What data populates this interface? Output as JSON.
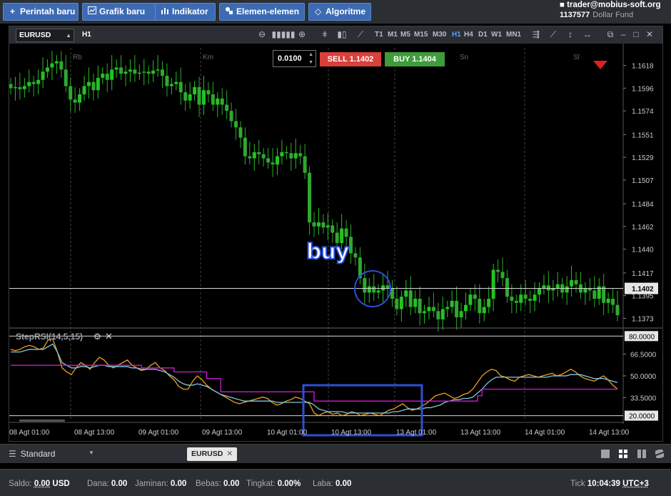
{
  "toolbar": {
    "new_order": "Perintah baru",
    "new_chart": "Grafik baru",
    "indicator": "Indikator",
    "elements": "Elemen-elemen",
    "algorithm": "Algoritme"
  },
  "account": {
    "email": "trader@mobius-soft.org",
    "number": "1137577",
    "fund": "Dollar Fund"
  },
  "chart": {
    "symbol": "EURUSD",
    "timeframe": "H1",
    "timeframes": [
      "T1",
      "M1",
      "M5",
      "M15",
      "M30",
      "H1",
      "H4",
      "D1",
      "W1",
      "MN1"
    ],
    "active_timeframe": "H1",
    "lot": "0.0100",
    "sell_label": "SELL",
    "sell_price": "1.1402",
    "buy_label": "BUY",
    "buy_price": "1.1404",
    "current_price": "1.1402",
    "day_markers": [
      "Rb",
      "Km",
      "Sn",
      "Sl"
    ],
    "annotation_buy": "buy",
    "colors": {
      "bull": "#22c322",
      "bear": "#2fa82f",
      "sell": "#d9403a",
      "buy": "#3e9c3a",
      "annotation": "#2b4fd8"
    }
  },
  "indicator": {
    "name": "StepRSI(14,5,15)",
    "levels": [
      "80.0000",
      "66.5000",
      "50.0000",
      "33.5000",
      "20.0000"
    ],
    "colors": {
      "rsi": "#f0a020",
      "fast": "#7fc8e0",
      "slow": "#d21ad2"
    }
  },
  "chart_data": {
    "type": "candlestick",
    "instrument": "EURUSD",
    "timeframe": "H1",
    "y_ticks": [
      1.1618,
      1.1596,
      1.1574,
      1.1551,
      1.1529,
      1.1507,
      1.1484,
      1.1462,
      1.144,
      1.1417,
      1.1395,
      1.1373
    ],
    "ylim": [
      1.1365,
      1.1635
    ],
    "x_ticks": [
      "08 Agt 01:00",
      "08 Agt 13:00",
      "09 Agt 01:00",
      "09 Agt 13:00",
      "10 Agt 01:00",
      "10 Agt 13:00",
      "13 Agt 01:00",
      "13 Agt 13:00",
      "14 Agt 01:00",
      "14 Agt 13:00"
    ],
    "close": [
      1.1596,
      1.1597,
      1.1595,
      1.1598,
      1.1602,
      1.16,
      1.1604,
      1.1612,
      1.1616,
      1.162,
      1.1622,
      1.1614,
      1.1598,
      1.1585,
      1.1582,
      1.159,
      1.1598,
      1.1602,
      1.1594,
      1.1606,
      1.161,
      1.1604,
      1.1614,
      1.1616,
      1.161,
      1.1612,
      1.1614,
      1.161,
      1.1611,
      1.1612,
      1.161,
      1.1613,
      1.1614,
      1.1608,
      1.1598,
      1.16,
      1.1602,
      1.1592,
      1.1584,
      1.159,
      1.1597,
      1.158,
      1.1594,
      1.159,
      1.158,
      1.1586,
      1.158,
      1.1574,
      1.1564,
      1.1558,
      1.1548,
      1.153,
      1.1528,
      1.1534,
      1.1532,
      1.1528,
      1.1524,
      1.1522,
      1.153,
      1.1534,
      1.1533,
      1.1528,
      1.1533,
      1.153,
      1.1514,
      1.1466,
      1.1462,
      1.1466,
      1.1461,
      1.1463,
      1.1456,
      1.1446,
      1.146,
      1.1452,
      1.1436,
      1.1432,
      1.1412,
      1.1398,
      1.1404,
      1.1398,
      1.14,
      1.1405,
      1.1402,
      1.1392,
      1.1382,
      1.1394,
      1.14,
      1.1384,
      1.1392,
      1.1378,
      1.138,
      1.1384,
      1.138,
      1.1372,
      1.1382,
      1.1384,
      1.139,
      1.1374,
      1.138,
      1.1386,
      1.1396,
      1.1392,
      1.1378,
      1.1384,
      1.1392,
      1.142,
      1.1418,
      1.1412,
      1.1394,
      1.139,
      1.1388,
      1.1396,
      1.1392,
      1.139,
      1.1396,
      1.1402,
      1.1405,
      1.14,
      1.1402,
      1.1406,
      1.1398,
      1.1404,
      1.141,
      1.1406,
      1.1398,
      1.1402,
      1.14,
      1.1392,
      1.1404,
      1.1388,
      1.1392,
      1.1386,
      1.1376
    ],
    "stepRSI": {
      "series": [
        {
          "name": "RSI",
          "values": [
            70,
            69,
            70,
            72,
            73,
            72,
            70,
            71,
            77,
            78,
            68,
            56,
            53,
            51,
            56,
            60,
            58,
            55,
            60,
            64,
            62,
            58,
            56,
            58,
            60,
            62,
            58,
            56,
            54,
            55,
            58,
            60,
            56,
            54,
            50,
            47,
            42,
            40,
            40,
            46,
            50,
            47,
            43,
            40,
            38,
            36,
            34,
            32,
            30,
            29,
            30,
            31,
            32,
            33,
            34,
            33,
            30,
            28,
            29,
            31,
            32,
            34,
            33,
            31,
            29,
            22,
            20,
            22,
            23,
            21,
            22,
            20,
            21,
            23,
            22,
            20,
            21,
            22,
            21,
            20,
            22,
            24,
            25,
            27,
            29,
            26,
            24,
            25,
            27,
            29,
            32,
            35,
            36,
            37,
            35,
            33,
            34,
            36,
            37,
            40,
            45,
            50,
            53,
            55,
            54,
            50,
            49,
            47,
            46,
            49,
            50,
            51,
            50,
            49,
            50,
            51,
            52,
            50,
            51,
            53,
            55,
            53,
            50,
            48,
            47,
            46,
            48,
            50,
            47,
            43,
            40
          ]
        },
        {
          "name": "Fast",
          "values": [
            68,
            68,
            68,
            69,
            70,
            70,
            70,
            70,
            72,
            74,
            68,
            60,
            58,
            56,
            56,
            57,
            57,
            56,
            57,
            58,
            58,
            57,
            57,
            57,
            57,
            57,
            56,
            56,
            55,
            55,
            55,
            55,
            54,
            53,
            51,
            49,
            46,
            44,
            43,
            43,
            44,
            43,
            42,
            40,
            38,
            36,
            35,
            34,
            33,
            32,
            31,
            31,
            31,
            31,
            31,
            31,
            31,
            30,
            30,
            30,
            30,
            30,
            30,
            30,
            30,
            28,
            25,
            24,
            23,
            23,
            23,
            23,
            22,
            22,
            22,
            22,
            22,
            22,
            22,
            22,
            22,
            22,
            23,
            23,
            24,
            25,
            25,
            25,
            25,
            26,
            26,
            27,
            28,
            30,
            31,
            32,
            32,
            33,
            33,
            34,
            37,
            40,
            44,
            47,
            49,
            49,
            49,
            49,
            49,
            49,
            49,
            49,
            49,
            49,
            49,
            49,
            50,
            50,
            50,
            50,
            51,
            51,
            51,
            50,
            49,
            48,
            48,
            48,
            47,
            46,
            45
          ]
        },
        {
          "name": "Slow",
          "values": [
            58,
            58,
            58,
            58,
            58,
            58,
            58,
            58,
            58,
            58,
            58,
            58,
            58,
            58,
            58,
            58,
            58,
            58,
            58,
            58,
            58,
            58,
            58,
            58,
            58,
            58,
            58,
            58,
            56,
            56,
            56,
            56,
            56,
            56,
            56,
            53,
            53,
            53,
            53,
            53,
            53,
            53,
            48,
            48,
            48,
            38,
            38,
            38,
            38,
            38,
            38,
            38,
            38,
            38,
            38,
            38,
            38,
            38,
            38,
            38,
            38,
            38,
            38,
            38,
            38,
            31,
            31,
            31,
            31,
            31,
            31,
            31,
            31,
            31,
            31,
            31,
            31,
            31,
            31,
            31,
            31,
            31,
            31,
            31,
            31,
            31,
            31,
            31,
            31,
            31,
            31,
            31,
            31,
            31,
            31,
            31,
            31,
            31,
            31,
            31,
            35,
            40,
            40,
            40,
            40,
            40,
            40,
            40,
            40,
            40,
            40,
            40,
            40,
            40,
            40,
            40,
            40,
            40,
            40,
            40,
            40,
            40,
            40,
            40,
            40,
            40,
            40,
            40,
            40,
            40,
            40
          ]
        }
      ],
      "ylim": [
        16,
        85
      ]
    }
  },
  "tabs": {
    "layout_label": "Standard",
    "symbol_tab": "EURUSD"
  },
  "status": {
    "saldo_label": "Saldo:",
    "saldo_value": "0.00",
    "saldo_currency": "USD",
    "dana_label": "Dana:",
    "dana_value": "0.00",
    "jaminan_label": "Jaminan:",
    "jaminan_value": "0.00",
    "bebas_label": "Bebas:",
    "bebas_value": "0.00",
    "tingkat_label": "Tingkat:",
    "tingkat_value": "0.00%",
    "laba_label": "Laba:",
    "laba_value": "0.00",
    "tick_label": "Tick",
    "time": "10:04:39",
    "timezone": "UTC+3"
  }
}
